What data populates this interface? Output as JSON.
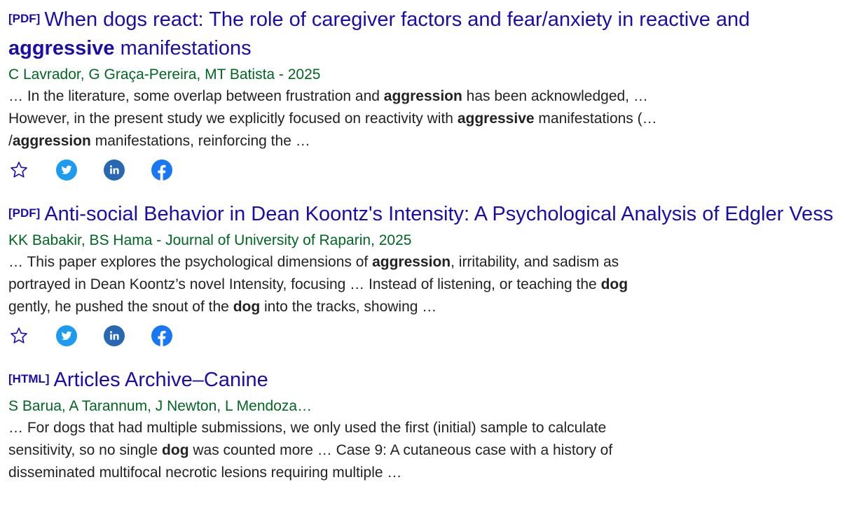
{
  "results": [
    {
      "type_tag": "[PDF]",
      "title_parts": [
        {
          "text": "When dogs react: The role of caregiver factors and fear/anxiety in reactive and ",
          "bold": false
        },
        {
          "text": "aggressive",
          "bold": true
        },
        {
          "text": " manifestations",
          "bold": false
        }
      ],
      "authors": "C Lavrador, G Graça-Pereira, MT Batista - 2025",
      "snippet_parts": [
        {
          "text": "… In the literature, some overlap between frustration and ",
          "bold": false
        },
        {
          "text": "aggression",
          "bold": true
        },
        {
          "text": " has been acknowledged, … However, in the present study we explicitly focused on reactivity with ",
          "bold": false
        },
        {
          "text": "aggressive",
          "bold": true
        },
        {
          "text": " manifestations (… /",
          "bold": false
        },
        {
          "text": "aggression",
          "bold": true
        },
        {
          "text": " manifestations, reinforcing the …",
          "bold": false
        }
      ],
      "actions": [
        "star-icon",
        "twitter-icon",
        "linkedin-icon",
        "facebook-icon"
      ]
    },
    {
      "type_tag": "[PDF]",
      "title_parts": [
        {
          "text": "Anti-social Behavior in Dean Koontz's Intensity: A Psychological Analysis of Edgler Vess",
          "bold": false
        }
      ],
      "authors": "KK Babakir, BS Hama - Journal of University of Raparin, 2025",
      "snippet_parts": [
        {
          "text": "… This paper explores the psychological dimensions of ",
          "bold": false
        },
        {
          "text": "aggression",
          "bold": true
        },
        {
          "text": ", irritability, and sadism as portrayed in Dean Koontz’s novel Intensity, focusing … Instead of listening, or teaching the ",
          "bold": false
        },
        {
          "text": "dog",
          "bold": true
        },
        {
          "text": " gently, he pushed the snout of the ",
          "bold": false
        },
        {
          "text": "dog",
          "bold": true
        },
        {
          "text": " into the tracks, showing …",
          "bold": false
        }
      ],
      "actions": [
        "star-icon",
        "twitter-icon",
        "linkedin-icon",
        "facebook-icon"
      ]
    },
    {
      "type_tag": "[HTML]",
      "title_parts": [
        {
          "text": "Articles Archive–Canine",
          "bold": false
        }
      ],
      "authors": "S Barua, A Tarannum, J Newton, L Mendoza…",
      "snippet_parts": [
        {
          "text": "… For dogs that had multiple submissions, we only used the first (initial) sample to calculate sensitivity, so no single ",
          "bold": false
        },
        {
          "text": "dog",
          "bold": true
        },
        {
          "text": " was counted more … Case 9: A cutaneous case with a history of disseminated multifocal necrotic lesions requiring multiple …",
          "bold": false
        }
      ],
      "actions": []
    }
  ],
  "colors": {
    "title_link": "#1a0dab",
    "authors": "#006621",
    "twitter": "#1d9bf0",
    "linkedin": "#2867b2",
    "facebook": "#1877f2",
    "star_outline": "#1a0dab"
  }
}
